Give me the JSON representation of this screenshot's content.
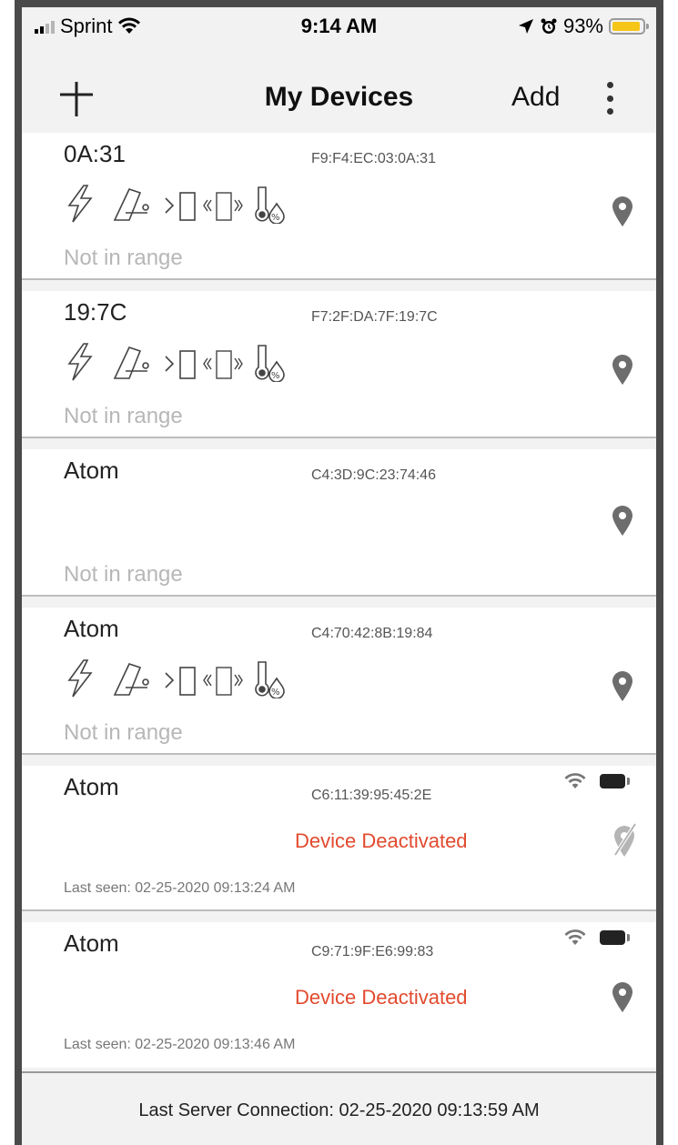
{
  "status_bar": {
    "carrier": "Sprint",
    "time": "9:14 AM",
    "battery_percent": "93%",
    "battery_level": 0.93,
    "icons": [
      "signal-icon",
      "wifi-icon",
      "location-arrow-icon",
      "alarm-icon",
      "battery-icon"
    ]
  },
  "nav": {
    "title": "My Devices",
    "add_label": "Add",
    "left_icon": "plus-icon",
    "right_icon": "more-vertical-icon"
  },
  "devices": [
    {
      "name": "0A:31",
      "mac": "F9:F4:EC:03:0A:31",
      "status": "Not in range",
      "sensor_icons": true,
      "pin": "location-pin-icon"
    },
    {
      "name": "19:7C",
      "mac": "F7:2F:DA:7F:19:7C",
      "status": "Not in range",
      "sensor_icons": true,
      "pin": "location-pin-icon"
    },
    {
      "name": "Atom",
      "mac": "C4:3D:9C:23:74:46",
      "status": "Not in range",
      "sensor_icons": false,
      "pin": "location-pin-icon"
    },
    {
      "name": "Atom",
      "mac": "C4:70:42:8B:19:84",
      "status": "Not in range",
      "sensor_icons": true,
      "pin": "location-pin-icon"
    },
    {
      "name": "Atom",
      "mac": "C6:11:39:95:45:2E",
      "deactivated": "Device Deactivated",
      "last_seen": "Last seen: 02-25-2020 09:13:24 AM",
      "pin": "location-pin-off-icon"
    },
    {
      "name": "Atom",
      "mac": "C9:71:9F:E6:99:83",
      "deactivated": "Device Deactivated",
      "last_seen": "Last seen: 02-25-2020 09:13:46 AM",
      "pin": "location-pin-icon"
    }
  ],
  "footer": {
    "text": "Last Server Connection: 02-25-2020 09:13:59 AM"
  },
  "colors": {
    "accent_red": "#e24a2e",
    "muted_text": "#b7b7b7",
    "background": "#f2f2f2"
  }
}
